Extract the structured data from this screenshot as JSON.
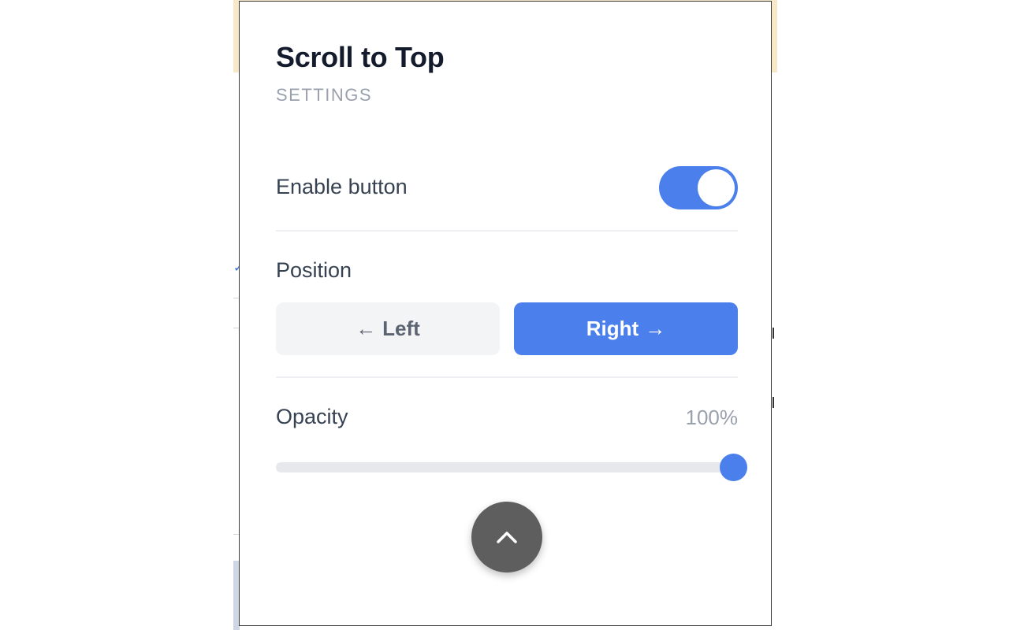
{
  "popup": {
    "title": "Scroll to Top",
    "subtitle": "SETTINGS"
  },
  "enable": {
    "label": "Enable button",
    "enabled": true
  },
  "position": {
    "label": "Position",
    "left_label": "Left",
    "right_label": "Right",
    "left_arrow": "←",
    "right_arrow": "→",
    "selected": "right"
  },
  "opacity": {
    "label": "Opacity",
    "value_text": "100%",
    "value": 100
  },
  "scroll_top_button": {
    "icon": "chevron-up-icon"
  },
  "colors": {
    "accent": "#4b7fec",
    "title": "#141b2d",
    "muted": "#9aa1ad",
    "fab": "#5e5e5e"
  }
}
